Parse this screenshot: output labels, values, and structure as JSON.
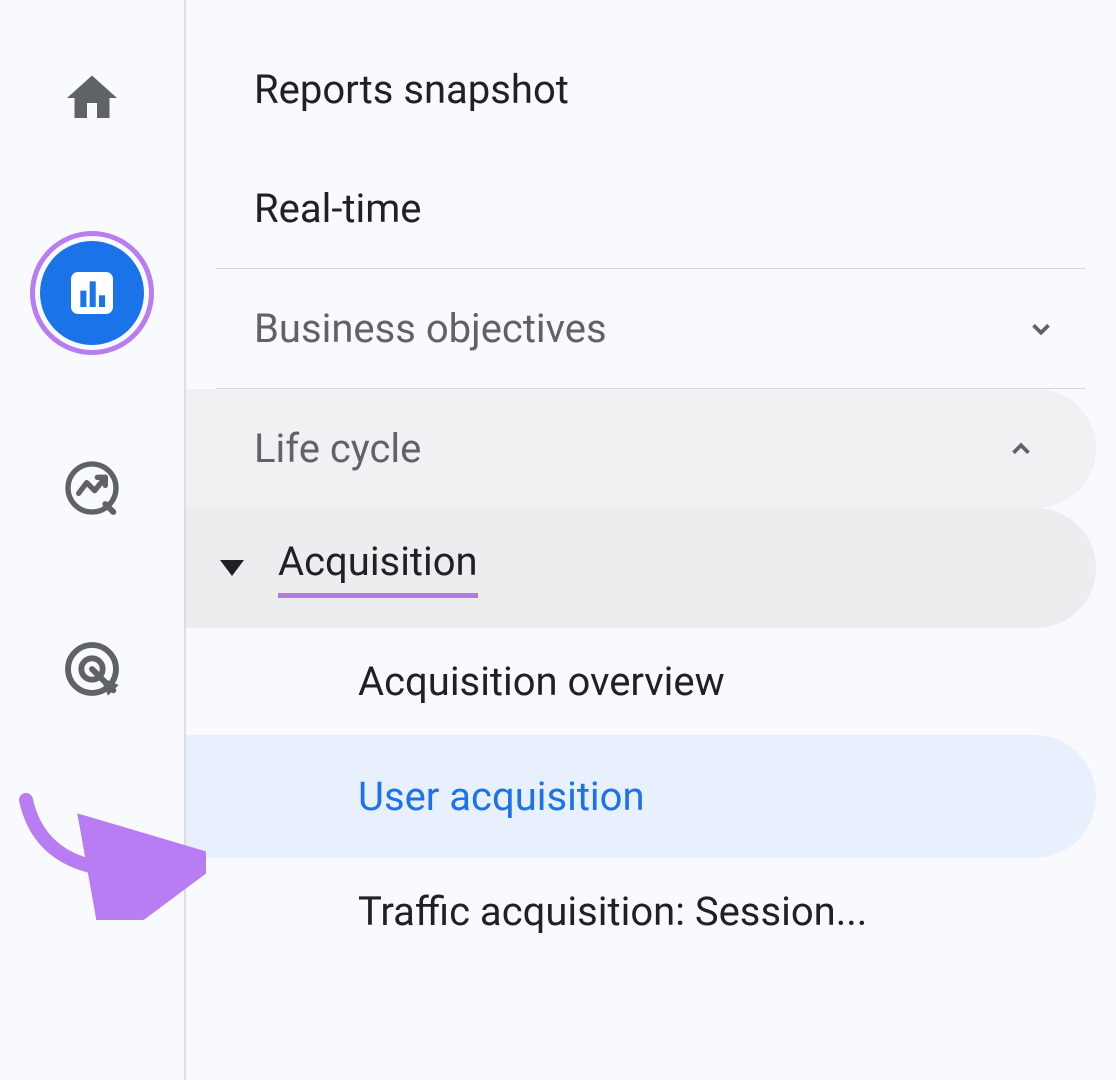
{
  "nav": {
    "reports_snapshot": "Reports snapshot",
    "realtime": "Real-time",
    "sections": {
      "business_objectives": {
        "label": "Business objectives",
        "expanded": false
      },
      "life_cycle": {
        "label": "Life cycle",
        "expanded": true,
        "subsections": {
          "acquisition": {
            "label": "Acquisition",
            "expanded": true,
            "items": [
              {
                "label": "Acquisition overview",
                "active": false
              },
              {
                "label": "User acquisition",
                "active": true
              },
              {
                "label": "Traffic acquisition: Session...",
                "active": false
              }
            ]
          }
        }
      }
    }
  },
  "rail": {
    "home": "home-icon",
    "reports": "barchart-icon",
    "explore": "trend-circle-icon",
    "advertising": "target-click-icon",
    "active": "reports"
  },
  "colors": {
    "accent_blue": "#1a73e8",
    "highlight_purple": "#b87df2",
    "text_primary": "#202124",
    "text_secondary": "#5f6368",
    "selected_bg": "#e8f0fe"
  }
}
